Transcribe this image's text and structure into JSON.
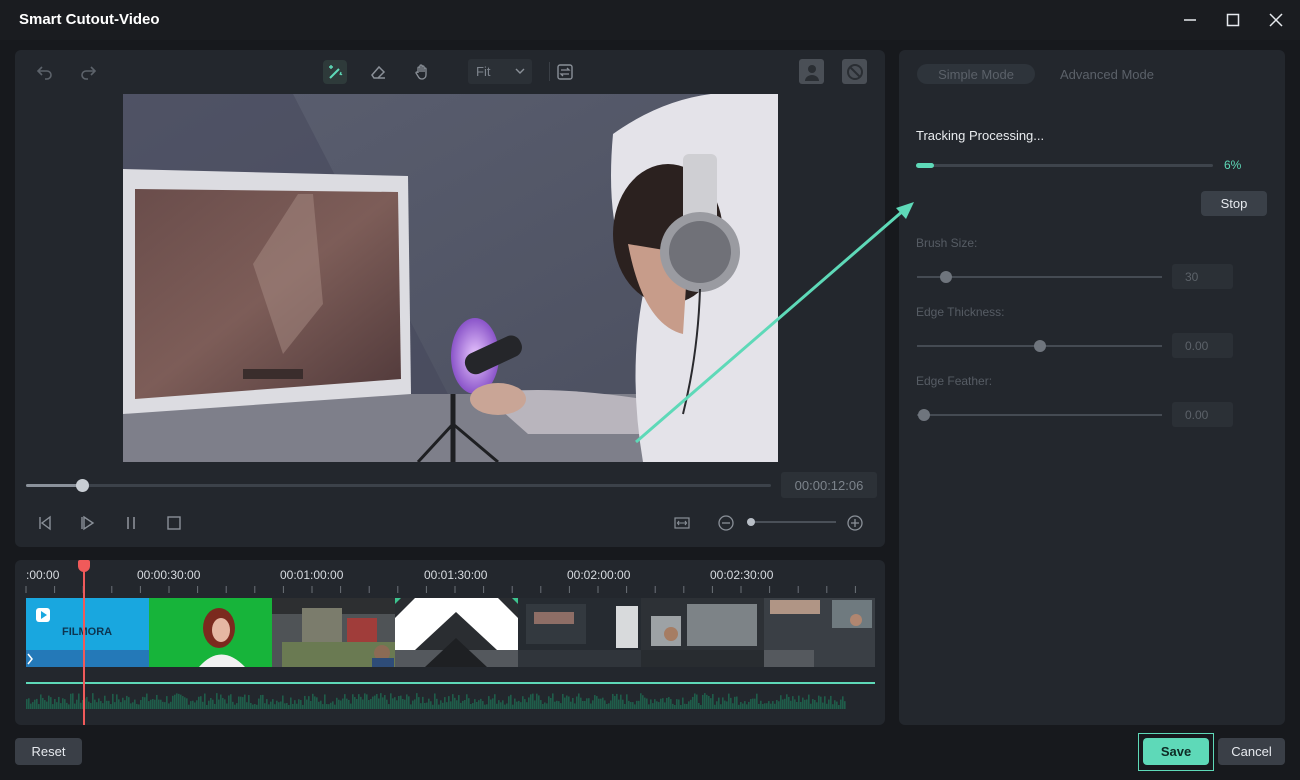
{
  "window": {
    "title": "Smart Cutout-Video",
    "minimize_icon": "minimize-icon",
    "maximize_icon": "maximize-icon",
    "close_icon": "close-icon"
  },
  "toolbar": {
    "fit_label": "Fit",
    "icons": [
      "undo-icon",
      "redo-icon",
      "smart-brush-icon",
      "eraser-icon",
      "hand-icon",
      "compare-icon",
      "person-icon",
      "disable-icon"
    ]
  },
  "playback": {
    "timecode": "00:00:12:06",
    "scrub_fraction": 0.075,
    "zoom_fraction": 0.04,
    "icons": [
      "prev-frame-icon",
      "play-icon",
      "pause-icon",
      "stop-icon",
      "fit-timeline-icon",
      "zoom-out-icon",
      "zoom-in-icon"
    ]
  },
  "timeline": {
    "ticks": [
      ":00:00",
      "00:00:30:00",
      "00:01:00:00",
      "00:01:30:00",
      "00:02:00:00",
      "00:02:30:00"
    ],
    "clips": [
      {
        "label": "FILMORA",
        "color": "#1aa8e0"
      },
      {
        "label": "",
        "color": "#18b83a"
      },
      {
        "label": "",
        "color": "#55595c"
      },
      {
        "label": "",
        "color": "#2a2d31"
      },
      {
        "label": "",
        "color": "#2b3138"
      },
      {
        "label": "",
        "color": "#3a3f45"
      },
      {
        "label": "",
        "color": "#40464c"
      }
    ],
    "audio_color": "#1f5d4a",
    "track_line_color": "#5ed9b8",
    "playhead_color": "#f05a5a"
  },
  "settings": {
    "mode_simple": "Simple Mode",
    "mode_advanced": "Advanced Mode",
    "processing_label": "Tracking Processing...",
    "progress_percent_text": "6%",
    "progress_fraction": 0.06,
    "stop_label": "Stop",
    "params": [
      {
        "label": "Brush Size:",
        "value": "30",
        "fraction": 0.12
      },
      {
        "label": "Edge Thickness:",
        "value": "0.00",
        "fraction": 0.5
      },
      {
        "label": "Edge Feather:",
        "value": "0.00",
        "fraction": 0.03
      }
    ]
  },
  "footer": {
    "reset_label": "Reset",
    "save_label": "Save",
    "cancel_label": "Cancel"
  },
  "colors": {
    "accent": "#5ed9b8",
    "panel": "#23272d",
    "background": "#17191d"
  }
}
